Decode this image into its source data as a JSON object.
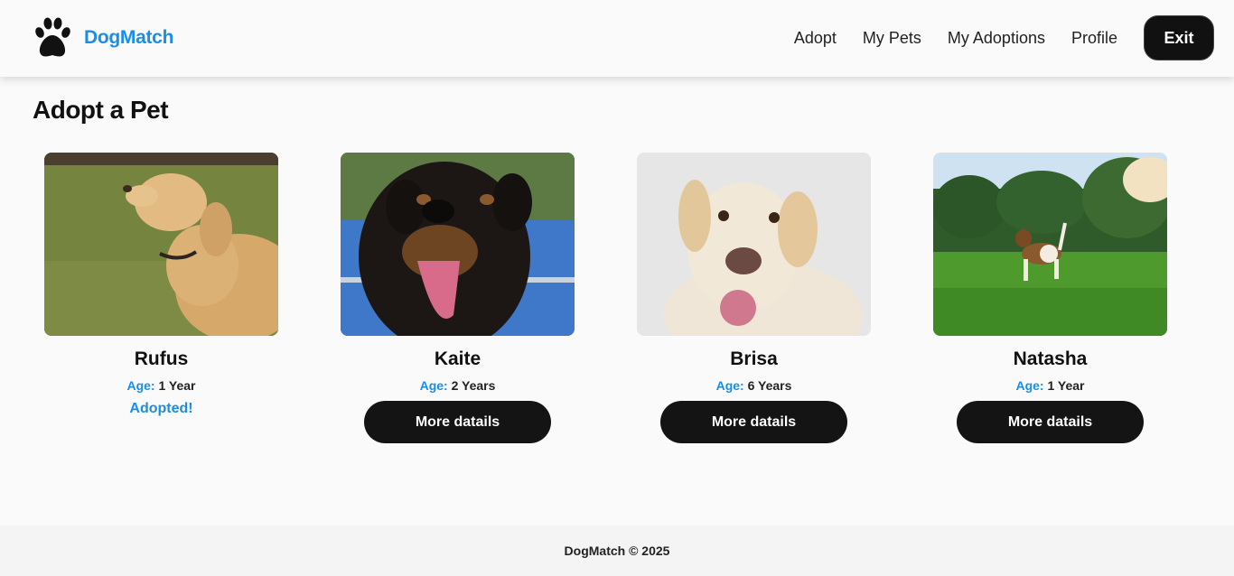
{
  "header": {
    "brand_name": "DogMatch",
    "brand_color": "#1a8ee6",
    "logo_icon": "paw-icon",
    "nav": [
      "Adopt",
      "My Pets",
      "My Adoptions",
      "Profile"
    ],
    "exit_label": "Exit"
  },
  "main": {
    "title": "Adopt a Pet",
    "pets": [
      {
        "name": "Rufus",
        "age_label": "Age:",
        "age": "1 Year",
        "status": "Adopted!"
      },
      {
        "name": "Kaite",
        "age_label": "Age:",
        "age": "2 Years",
        "button": "More datails"
      },
      {
        "name": "Brisa",
        "age_label": "Age:",
        "age": "6 Years",
        "button": "More datails"
      },
      {
        "name": "Natasha",
        "age_label": "Age:",
        "age": "1 Year",
        "button": "More datails"
      }
    ]
  },
  "footer": {
    "text": "DogMatch © 2025"
  }
}
